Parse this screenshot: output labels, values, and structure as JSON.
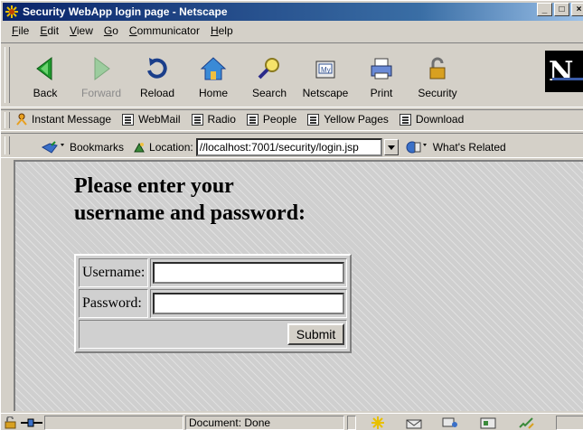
{
  "window": {
    "title": "Security WebApp login page - Netscape",
    "controls": {
      "minimize": "_",
      "maximize": "□",
      "close": "×"
    }
  },
  "menu": [
    {
      "label": "File",
      "accel": "F",
      "rest": "ile"
    },
    {
      "label": "Edit",
      "accel": "E",
      "rest": "dit"
    },
    {
      "label": "View",
      "accel": "V",
      "rest": "iew"
    },
    {
      "label": "Go",
      "accel": "G",
      "rest": "o"
    },
    {
      "label": "Communicator",
      "accel": "C",
      "rest": "ommunicator"
    },
    {
      "label": "Help",
      "accel": "H",
      "rest": "elp"
    }
  ],
  "nav_toolbar": [
    {
      "label": "Back",
      "icon": "back-arrow-icon",
      "enabled": true
    },
    {
      "label": "Forward",
      "icon": "forward-arrow-icon",
      "enabled": false
    },
    {
      "label": "Reload",
      "icon": "reload-icon",
      "enabled": true
    },
    {
      "label": "Home",
      "icon": "home-icon",
      "enabled": true
    },
    {
      "label": "Search",
      "icon": "search-icon",
      "enabled": true
    },
    {
      "label": "Netscape",
      "icon": "netscape-icon",
      "enabled": true
    },
    {
      "label": "Print",
      "icon": "print-icon",
      "enabled": true
    },
    {
      "label": "Security",
      "icon": "lock-icon",
      "enabled": true
    }
  ],
  "logo_letter": "N",
  "personal_toolbar": [
    {
      "label": "Instant Message",
      "icon": "instant-message-icon"
    },
    {
      "label": "WebMail",
      "icon": "bookmark-page-icon"
    },
    {
      "label": "Radio",
      "icon": "bookmark-page-icon"
    },
    {
      "label": "People",
      "icon": "bookmark-page-icon"
    },
    {
      "label": "Yellow Pages",
      "icon": "bookmark-page-icon"
    },
    {
      "label": "Download",
      "icon": "bookmark-page-icon"
    }
  ],
  "location_bar": {
    "bookmarks_label": "Bookmarks",
    "location_label": "Location:",
    "url": "//localhost:7001/security/login.jsp",
    "whats_related_label": "What's Related"
  },
  "page": {
    "heading_line1": "Please enter your",
    "heading_line2": "username and password:",
    "username_label": "Username:",
    "username_value": "",
    "password_label": "Password:",
    "password_value": "",
    "submit_label": "Submit"
  },
  "status_bar": {
    "status_text": "Document: Done"
  },
  "colors": {
    "title_bar": "#0a246a",
    "chrome": "#d4d0c8",
    "content_bg": "#cfcfcf"
  }
}
